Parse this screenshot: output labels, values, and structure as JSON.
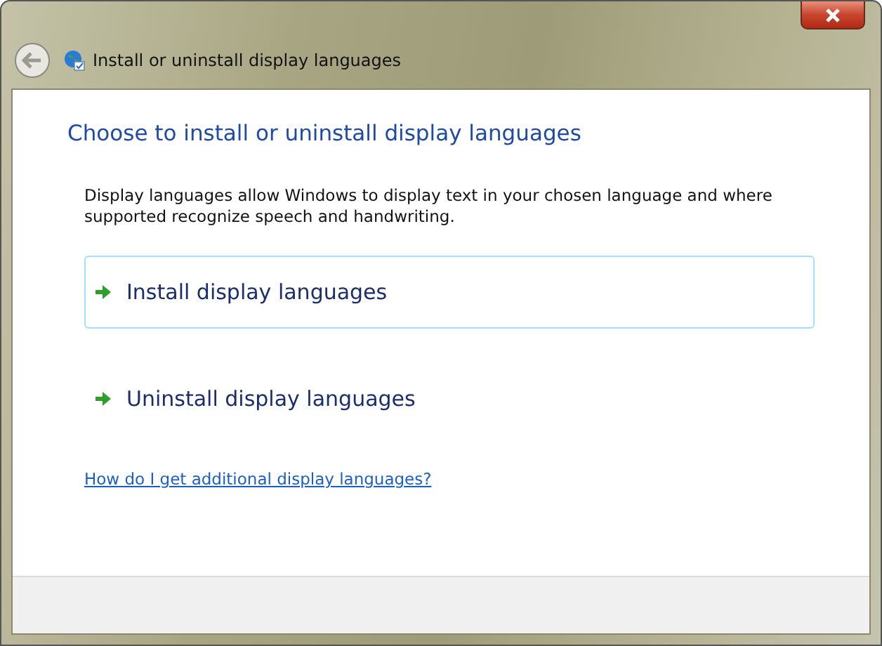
{
  "window": {
    "title": "Install or uninstall display languages"
  },
  "heading": "Choose to install or uninstall display languages",
  "description": "Display languages allow Windows to display text in your chosen language and where supported recognize speech and handwriting.",
  "options": [
    {
      "label": "Install display languages",
      "selected": true
    },
    {
      "label": "Uninstall display languages",
      "selected": false
    }
  ],
  "help_link": "How do I get additional display languages?"
}
